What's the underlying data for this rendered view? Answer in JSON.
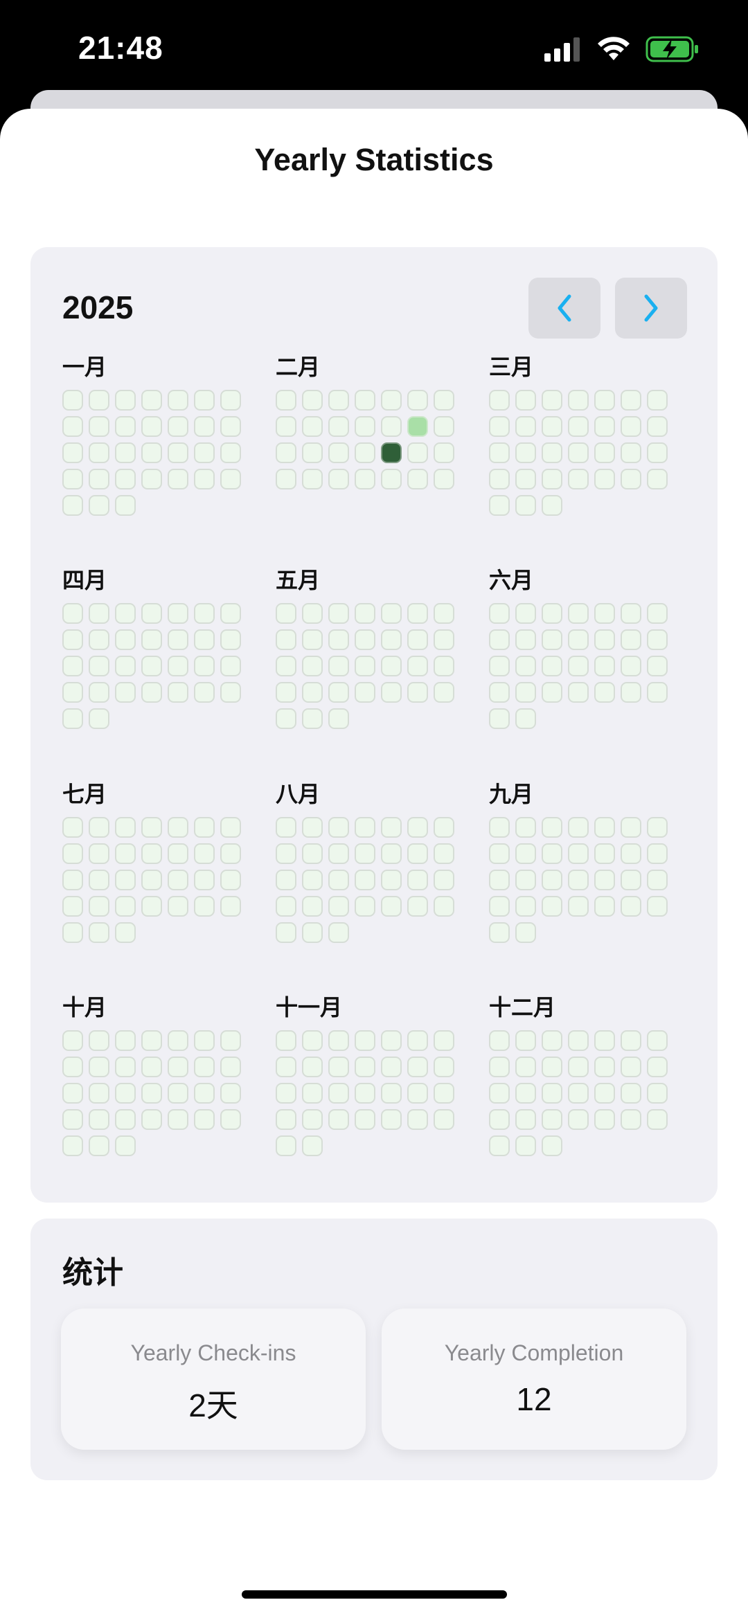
{
  "status_bar": {
    "time": "21:48"
  },
  "title": "Yearly Statistics",
  "calendar": {
    "year": "2025",
    "prev_icon": "chevron-left-icon",
    "next_icon": "chevron-right-icon",
    "accent_color": "#1ab0f0",
    "months": [
      {
        "label": "一月",
        "days": 31,
        "levels": {}
      },
      {
        "label": "二月",
        "days": 28,
        "levels": {
          "13": 1,
          "19": 3
        }
      },
      {
        "label": "三月",
        "days": 31,
        "levels": {}
      },
      {
        "label": "四月",
        "days": 30,
        "levels": {}
      },
      {
        "label": "五月",
        "days": 31,
        "levels": {}
      },
      {
        "label": "六月",
        "days": 30,
        "levels": {}
      },
      {
        "label": "七月",
        "days": 31,
        "levels": {}
      },
      {
        "label": "八月",
        "days": 31,
        "levels": {}
      },
      {
        "label": "九月",
        "days": 30,
        "levels": {}
      },
      {
        "label": "十月",
        "days": 31,
        "levels": {}
      },
      {
        "label": "十一月",
        "days": 30,
        "levels": {}
      },
      {
        "label": "十二月",
        "days": 31,
        "levels": {}
      }
    ]
  },
  "stats": {
    "title": "统计",
    "checkins_label": "Yearly Check-ins",
    "checkins_value": "2天",
    "completion_label": "Yearly Completion",
    "completion_value": "12"
  }
}
